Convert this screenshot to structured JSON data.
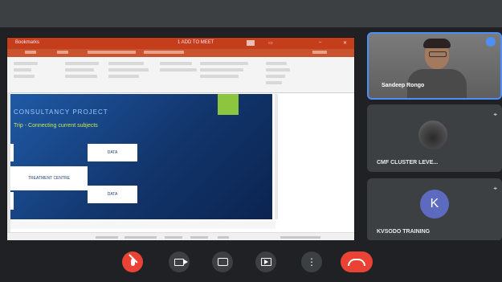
{
  "ppt": {
    "title_left": "Bookmarks",
    "title_center": "1 ADD TO MEET",
    "slide_title": "CONSULTANCY PROJECT",
    "slide_subtitle": "Trip - Connecting current subjects",
    "box_left": "TREATMENT CENTRE",
    "box_top": "DATA",
    "box_bottom": "DATA"
  },
  "participants": [
    {
      "name": "Sandeep Rongo",
      "kind": "video"
    },
    {
      "name": "CMF CLUSTER LEVE...",
      "kind": "photo"
    },
    {
      "name": "KVSODO TRAINING",
      "kind": "avatar",
      "initial": "K"
    }
  ],
  "controls": [
    {
      "icon": "mic-off-icon",
      "color": "#ea4335"
    },
    {
      "icon": "camera-icon",
      "color": "#3c4043"
    },
    {
      "icon": "captions-icon",
      "color": "#3c4043"
    },
    {
      "icon": "present-icon",
      "color": "#3c4043"
    },
    {
      "icon": "more-options-icon",
      "color": "#3c4043"
    },
    {
      "icon": "hang-up-icon",
      "color": "#ea4335"
    }
  ]
}
